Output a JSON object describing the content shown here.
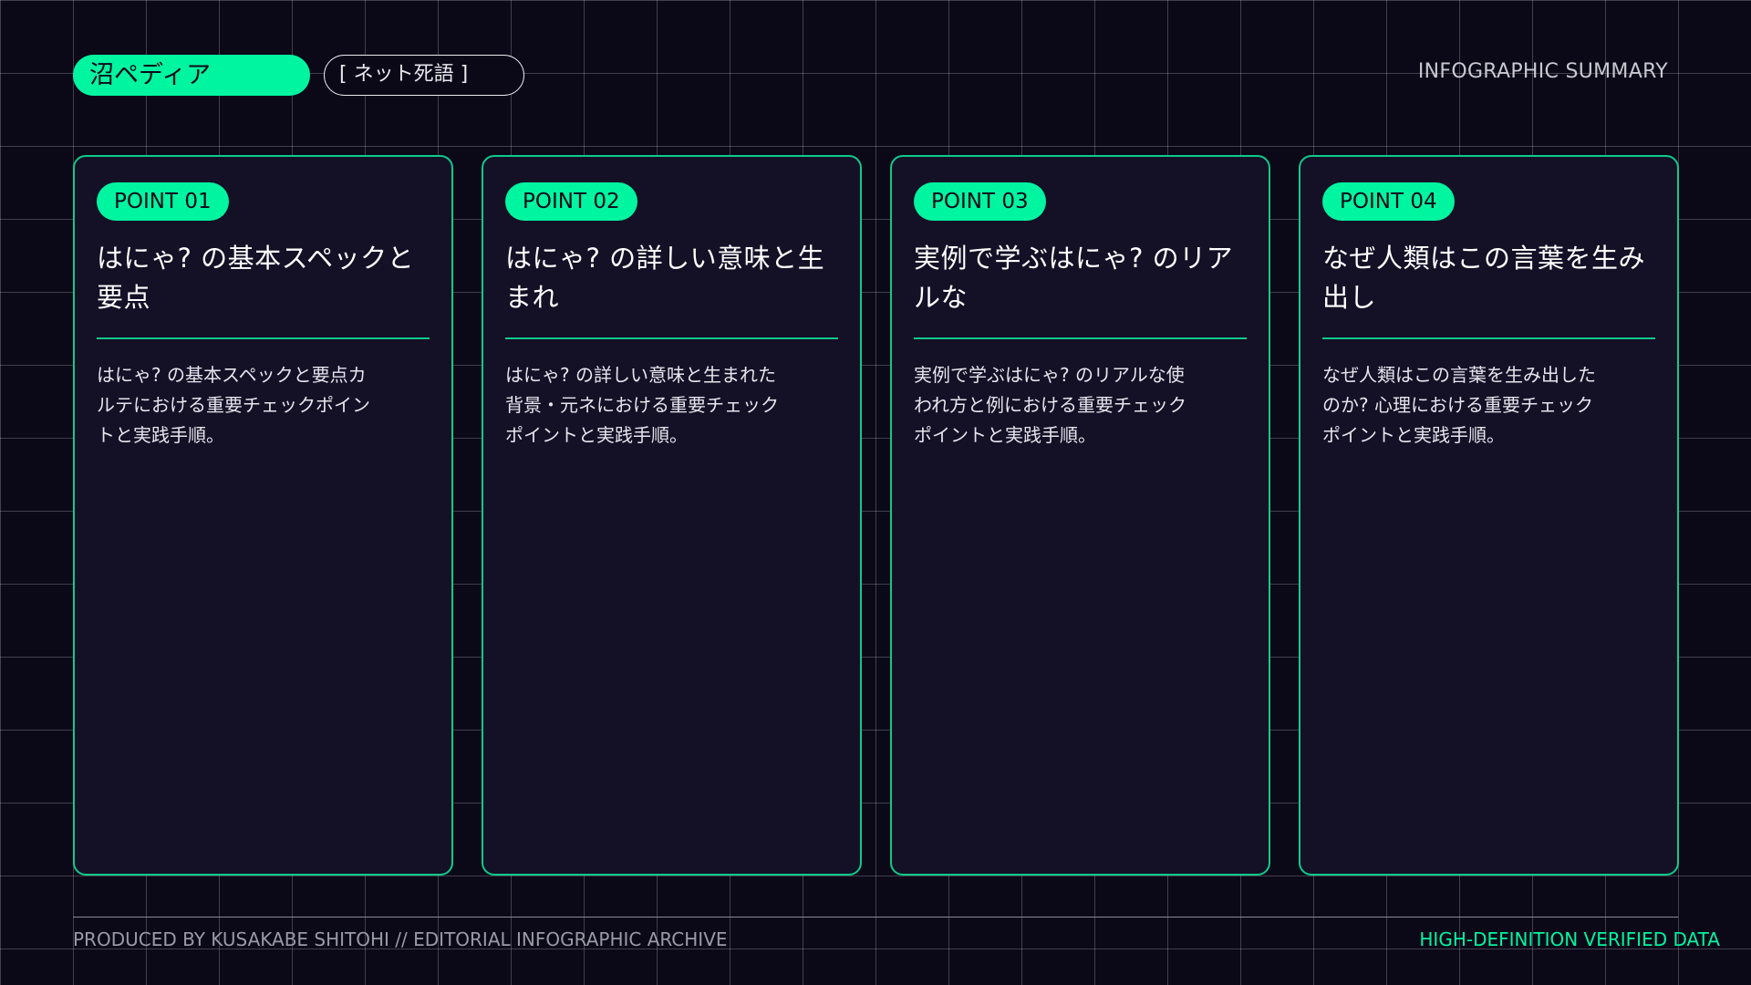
{
  "header": {
    "brand": "沼ペディア",
    "category": "[ ネット死語 ]",
    "summary_label": "INFOGRAPHIC SUMMARY"
  },
  "cards": [
    {
      "badge": "POINT 01",
      "title": "はにゃ? の基本スペックと要点",
      "body": "はにゃ? の基本スペックと要点カルテにおける重要チェックポイントと実践手順。"
    },
    {
      "badge": "POINT 02",
      "title": "はにゃ? の詳しい意味と生まれ",
      "body": "はにゃ? の詳しい意味と生まれた背景・元ネにおける重要チェックポイントと実践手順。"
    },
    {
      "badge": "POINT 03",
      "title": "実例で学ぶはにゃ? のリアルな",
      "body": "実例で学ぶはにゃ? のリアルな使われ方と例における重要チェックポイントと実践手順。"
    },
    {
      "badge": "POINT 04",
      "title": "なぜ人類はこの言葉を生み出し",
      "body": "なぜ人類はこの言葉を生み出したのか? 心理における重要チェックポイントと実践手順。"
    }
  ],
  "footer": {
    "credit": "PRODUCED BY KUSAKABE SHITOHI // EDITORIAL INFOGRAPHIC ARCHIVE",
    "verified": "HIGH-DEFINITION VERIFIED DATA"
  },
  "colors": {
    "accent": "#00f5a0",
    "card_border": "#10c98a",
    "background": "#0b0918",
    "card_background": "#141026"
  }
}
